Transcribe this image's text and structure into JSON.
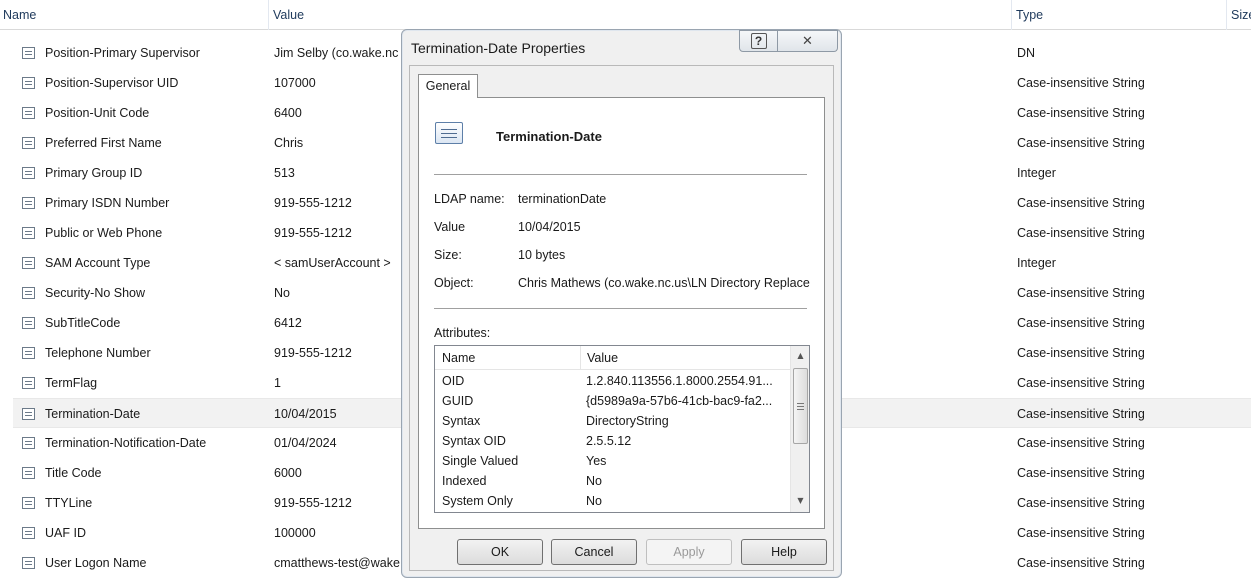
{
  "columns": {
    "name": "Name",
    "value": "Value",
    "type": "Type",
    "size": "Size"
  },
  "rows": [
    {
      "name": "Position-Primary Supervisor",
      "value": "Jim Selby (co.wake.nc",
      "type": "DN"
    },
    {
      "name": "Position-Supervisor UID",
      "value": "107000",
      "type": "Case-insensitive String"
    },
    {
      "name": "Position-Unit Code",
      "value": "6400",
      "type": "Case-insensitive String"
    },
    {
      "name": "Preferred First Name",
      "value": "Chris",
      "type": "Case-insensitive String"
    },
    {
      "name": "Primary Group ID",
      "value": "513",
      "type": "Integer"
    },
    {
      "name": "Primary ISDN Number",
      "value": "919-555-1212",
      "type": "Case-insensitive String"
    },
    {
      "name": "Public or Web Phone",
      "value": "919-555-1212",
      "type": "Case-insensitive String"
    },
    {
      "name": "SAM Account Type",
      "value": "< samUserAccount >",
      "type": "Integer"
    },
    {
      "name": "Security-No Show",
      "value": "No",
      "type": "Case-insensitive String"
    },
    {
      "name": "SubTitleCode",
      "value": "6412",
      "type": "Case-insensitive String"
    },
    {
      "name": "Telephone Number",
      "value": "919-555-1212",
      "type": "Case-insensitive String"
    },
    {
      "name": "TermFlag",
      "value": "1",
      "type": "Case-insensitive String"
    },
    {
      "name": "Termination-Date",
      "value": "10/04/2015",
      "type": "Case-insensitive String",
      "selected": true
    },
    {
      "name": "Termination-Notification-Date",
      "value": "01/04/2024",
      "type": "Case-insensitive String"
    },
    {
      "name": "Title Code",
      "value": "6000",
      "type": "Case-insensitive String"
    },
    {
      "name": "TTYLine",
      "value": "919-555-1212",
      "type": "Case-insensitive String"
    },
    {
      "name": "UAF ID",
      "value": "100000",
      "type": "Case-insensitive String"
    },
    {
      "name": "User Logon Name",
      "value": "cmatthews-test@wake",
      "type": "Case-insensitive String"
    }
  ],
  "dialog": {
    "title": "Termination-Date Properties",
    "help_glyph": "?",
    "close_glyph": "✕",
    "tab": "General",
    "object_name": "Termination-Date",
    "props": [
      {
        "label": "LDAP name:",
        "value": "terminationDate"
      },
      {
        "label": "Value",
        "value": "10/04/2015"
      },
      {
        "label": "Size:",
        "value": "10 bytes"
      },
      {
        "label": "Object:",
        "value": "Chris Mathews (co.wake.nc.us\\LN Directory Replace"
      }
    ],
    "attributes_label": "Attributes:",
    "attr_columns": {
      "name": "Name",
      "value": "Value"
    },
    "attributes": [
      {
        "name": "OID",
        "value": "1.2.840.113556.1.8000.2554.91..."
      },
      {
        "name": "GUID",
        "value": "{d5989a9a-57b6-41cb-bac9-fa2..."
      },
      {
        "name": "Syntax",
        "value": "DirectoryString"
      },
      {
        "name": "Syntax OID",
        "value": "2.5.5.12"
      },
      {
        "name": "Single Valued",
        "value": "Yes"
      },
      {
        "name": "Indexed",
        "value": "No"
      },
      {
        "name": "System Only",
        "value": "No"
      }
    ],
    "buttons": {
      "ok": "OK",
      "cancel": "Cancel",
      "apply": "Apply",
      "help": "Help"
    },
    "scroll_up": "▲",
    "scroll_down": "▼"
  },
  "colors": {
    "header_text": "#1e395b",
    "selected_row": "#f2f2f2",
    "dialog_bg": "#f0f0f0"
  }
}
